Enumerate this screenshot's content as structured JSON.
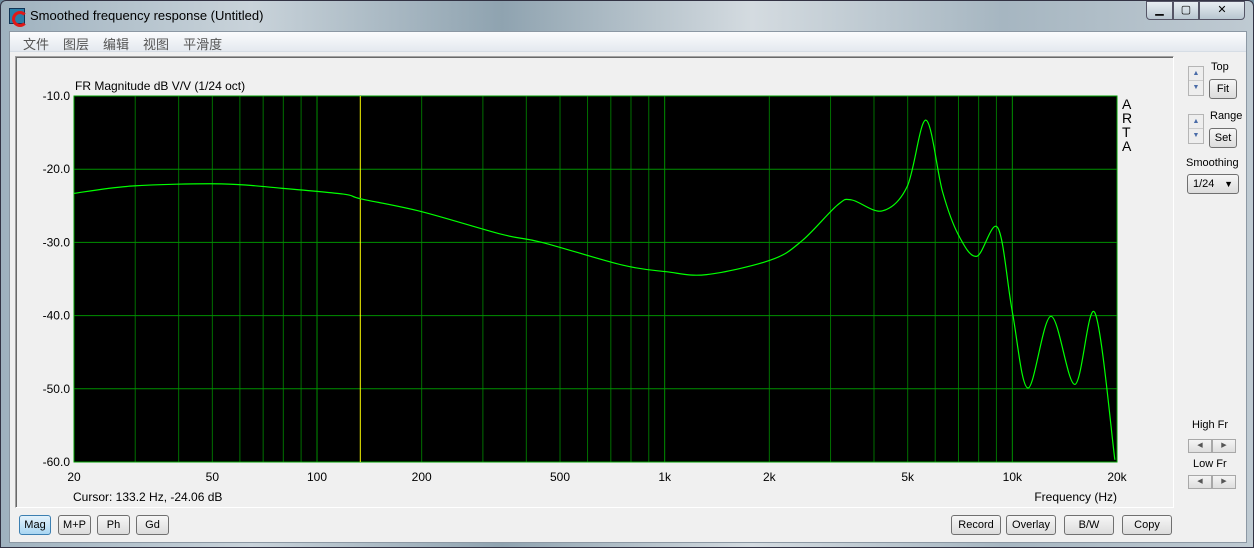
{
  "window": {
    "title": "Smoothed frequency response (Untitled)",
    "controls": [
      "minimize",
      "maximize",
      "close"
    ]
  },
  "menu": [
    "文件",
    "图层",
    "编辑",
    "视图",
    "平滑度"
  ],
  "side": {
    "top_label": "Top",
    "fit_label": "Fit",
    "range_label": "Range",
    "set_label": "Set",
    "smoothing_label": "Smoothing",
    "smoothing_value": "1/24",
    "high_fr_label": "High Fr",
    "low_fr_label": "Low Fr"
  },
  "chart_title": "FR Magnitude dB V/V (1/24 oct)",
  "watermark": "ARTA",
  "cursor_text": "Cursor: 133.2 Hz, -24.06 dB",
  "xlabel": "Frequency (Hz)",
  "bottom_buttons": {
    "mag": "Mag",
    "mp": "M+P",
    "ph": "Ph",
    "gd": "Gd",
    "record": "Record",
    "overlay": "Overlay",
    "bw": "B/W",
    "copy": "Copy"
  },
  "colors": {
    "plot_bg": "#000000",
    "curve": "#00ff00",
    "grid": "#007000",
    "cursor": "#ffff00",
    "active_button": "#a9d6f2"
  },
  "chart_data": {
    "type": "line",
    "title": "FR Magnitude dB V/V (1/24 oct)",
    "xlabel": "Frequency (Hz)",
    "ylabel": "",
    "xscale": "log",
    "xlim": [
      20,
      20000
    ],
    "ylim": [
      -60,
      -10
    ],
    "grid": true,
    "xticks": [
      {
        "v": 20,
        "l": "20"
      },
      {
        "v": 50,
        "l": "50"
      },
      {
        "v": 100,
        "l": "100"
      },
      {
        "v": 200,
        "l": "200"
      },
      {
        "v": 500,
        "l": "500"
      },
      {
        "v": 1000,
        "l": "1k"
      },
      {
        "v": 2000,
        "l": "2k"
      },
      {
        "v": 5000,
        "l": "5k"
      },
      {
        "v": 10000,
        "l": "10k"
      },
      {
        "v": 20000,
        "l": "20k"
      }
    ],
    "yticks": [
      {
        "v": -10,
        "l": "-10.0"
      },
      {
        "v": -20,
        "l": "-20.0"
      },
      {
        "v": -30,
        "l": "-30.0"
      },
      {
        "v": -40,
        "l": "-40.0"
      },
      {
        "v": -50,
        "l": "-50.0"
      },
      {
        "v": -60,
        "l": "-60.0"
      }
    ],
    "cursor": {
      "freq": 133.2,
      "db": -24.06
    },
    "x": [
      20,
      29.4,
      53,
      79,
      119,
      134,
      200,
      340,
      444,
      756,
      1010,
      1320,
      2020,
      2480,
      3140,
      3450,
      4220,
      4980,
      5640,
      6300,
      7000,
      7900,
      9080,
      10000,
      11090,
      12910,
      15130,
      17270,
      19720
    ],
    "y": [
      -23.3,
      -22.3,
      -22.0,
      -22.6,
      -23.4,
      -24.06,
      -25.8,
      -28.9,
      -30.0,
      -33.1,
      -34.0,
      -34.4,
      -32.4,
      -29.8,
      -24.9,
      -24.2,
      -25.7,
      -22.4,
      -13.3,
      -23.1,
      -29.0,
      -31.9,
      -28.0,
      -39.5,
      -49.9,
      -40.1,
      -49.4,
      -39.6,
      -59.7
    ]
  }
}
